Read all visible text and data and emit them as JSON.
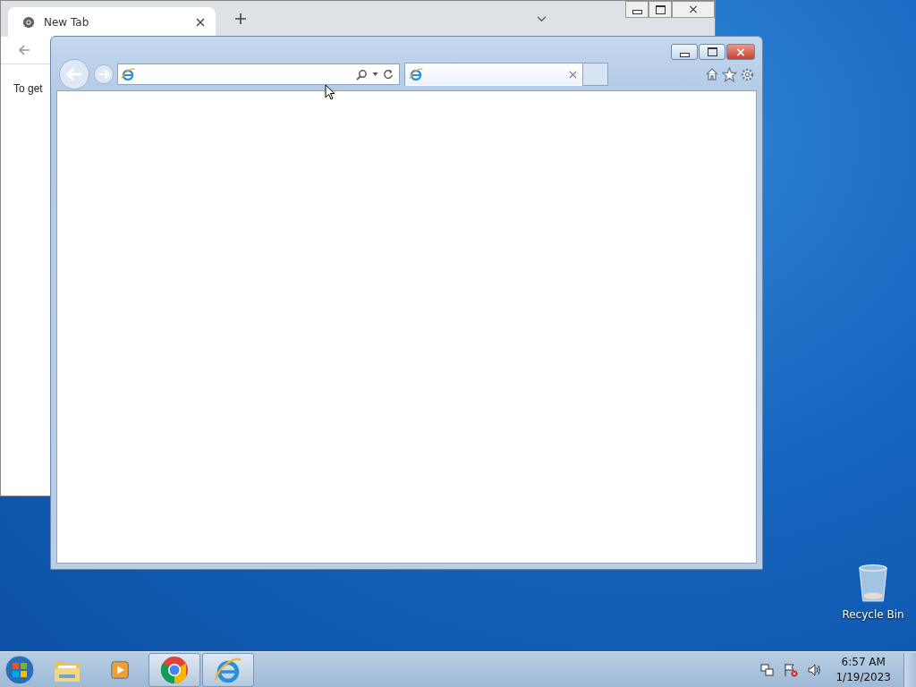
{
  "chrome_window": {
    "tab_title": "New Tab",
    "content_text": "To get"
  },
  "ie_window": {
    "tabs": [
      {
        "selected": true
      }
    ]
  },
  "desktop_icons": [
    {
      "label": "Recycle Bin"
    }
  ],
  "taskbar": {
    "apps": [
      {
        "kind": "explorer",
        "running": false
      },
      {
        "kind": "media",
        "running": false
      },
      {
        "kind": "chrome",
        "running": true
      },
      {
        "kind": "ie",
        "running": true
      }
    ],
    "clock": {
      "time": "6:57 AM",
      "date": "1/19/2023"
    }
  }
}
